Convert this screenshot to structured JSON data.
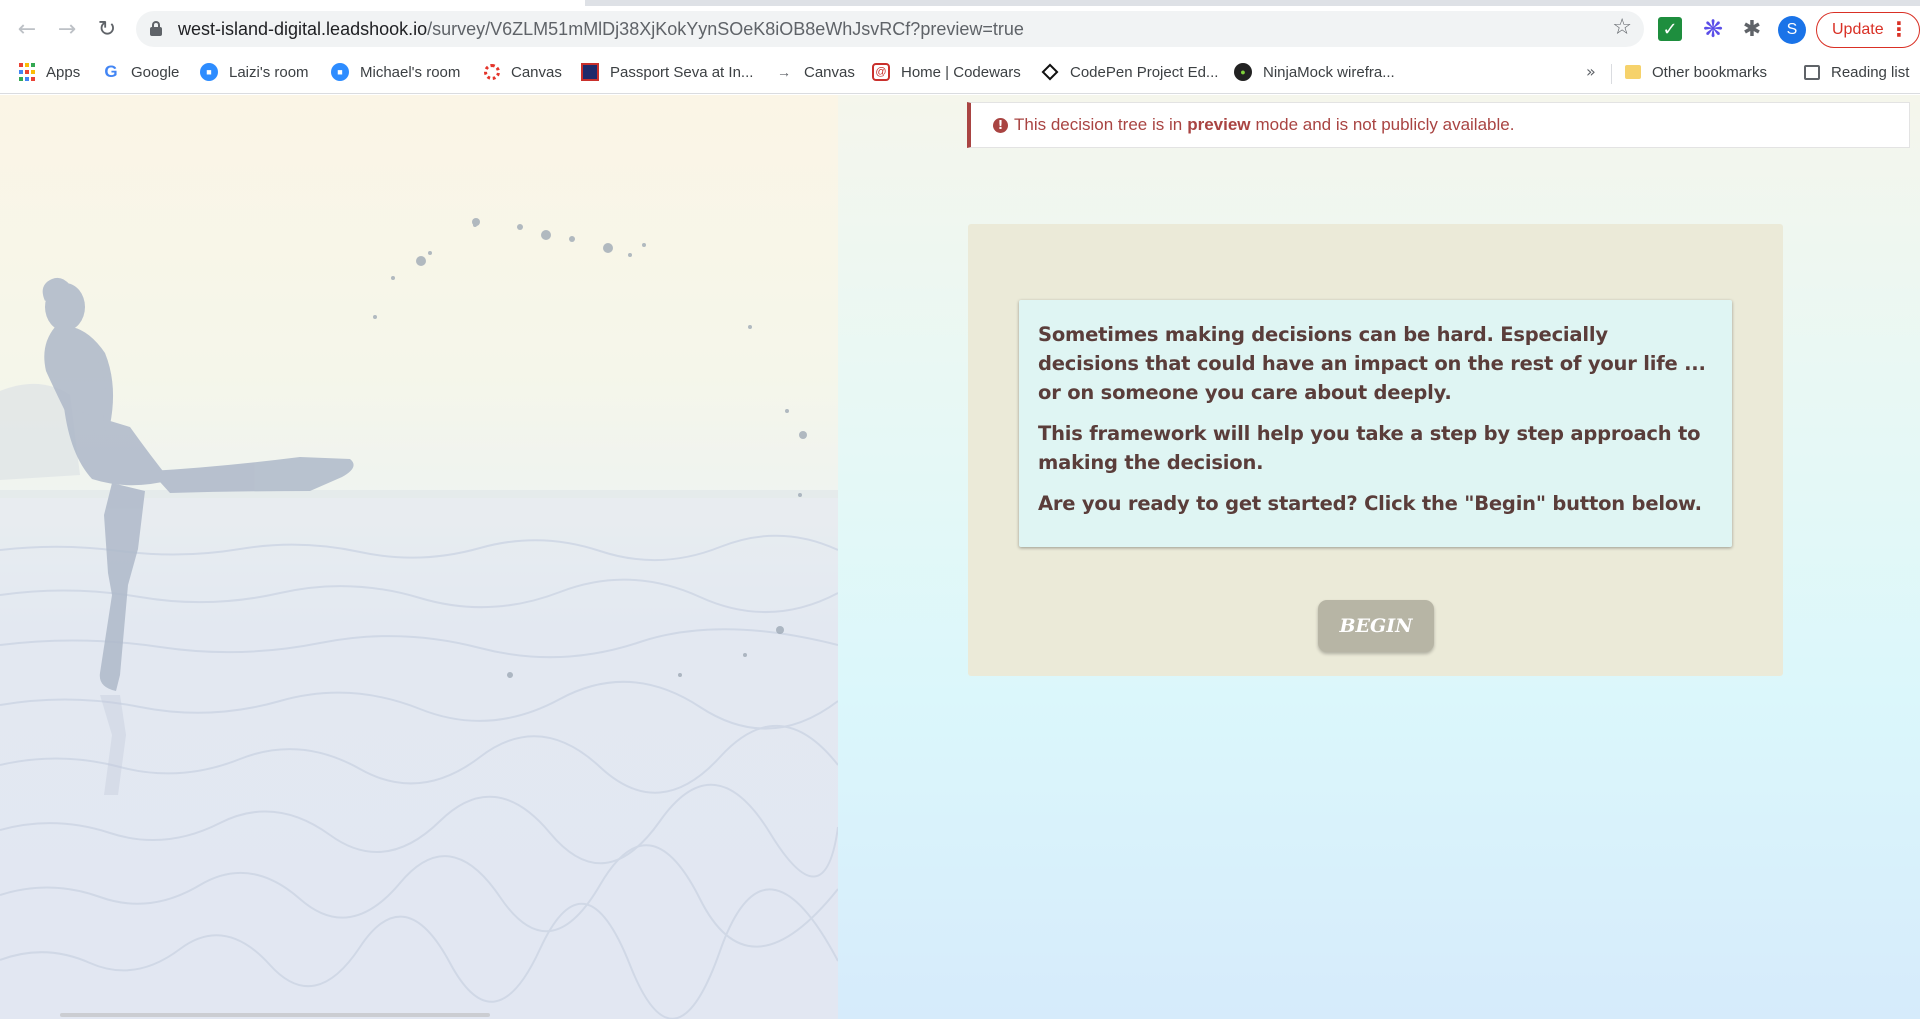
{
  "browser": {
    "url_host": "west-island-digital.leadshook.io",
    "url_path": "/survey/V6ZLM51mMlDj38XjKokYynSOeK8iOB8eWhJsvRCf?preview=true",
    "profile_initial": "S",
    "update_label": "Update",
    "bookmarks": [
      {
        "label": "Apps",
        "icon": "apps-grid-icon"
      },
      {
        "label": "Google",
        "icon": "google-icon"
      },
      {
        "label": "Laizi's room",
        "icon": "zoom-icon"
      },
      {
        "label": "Michael's room",
        "icon": "zoom-icon"
      },
      {
        "label": "Canvas",
        "icon": "canvas-icon"
      },
      {
        "label": "Passport Seva at In...",
        "icon": "passport-seva-icon"
      },
      {
        "label": "Canvas",
        "icon": "arrow-icon"
      },
      {
        "label": "Home | Codewars",
        "icon": "codewars-icon"
      },
      {
        "label": "CodePen Project Ed...",
        "icon": "codepen-icon"
      },
      {
        "label": "NinjaMock wirefra...",
        "icon": "ninjamock-icon"
      }
    ],
    "more_bookmarks": "»",
    "other_bookmarks": "Other bookmarks",
    "reading_list": "Reading list"
  },
  "alert": {
    "before": "This decision tree is in",
    "highlight": "preview",
    "after": "mode and is not publicly available."
  },
  "intro": {
    "paragraph1": "Sometimes making decisions can be hard.  Especially decisions that could have an impact on the rest of your life ... or on someone  you care about deeply.",
    "paragraph2": "This framework will help you take a step by step approach to making the decision.",
    "paragraph3": "Are you ready to get started?  Click the \"Begin\" button below."
  },
  "begin_label": "BEGIN",
  "colors": {
    "alert_red": "#a94442",
    "card_bg": "#ebead8",
    "intro_bg": "#dff5f3",
    "intro_text": "#5a3d3a",
    "button_bg": "#b7b5a5"
  }
}
